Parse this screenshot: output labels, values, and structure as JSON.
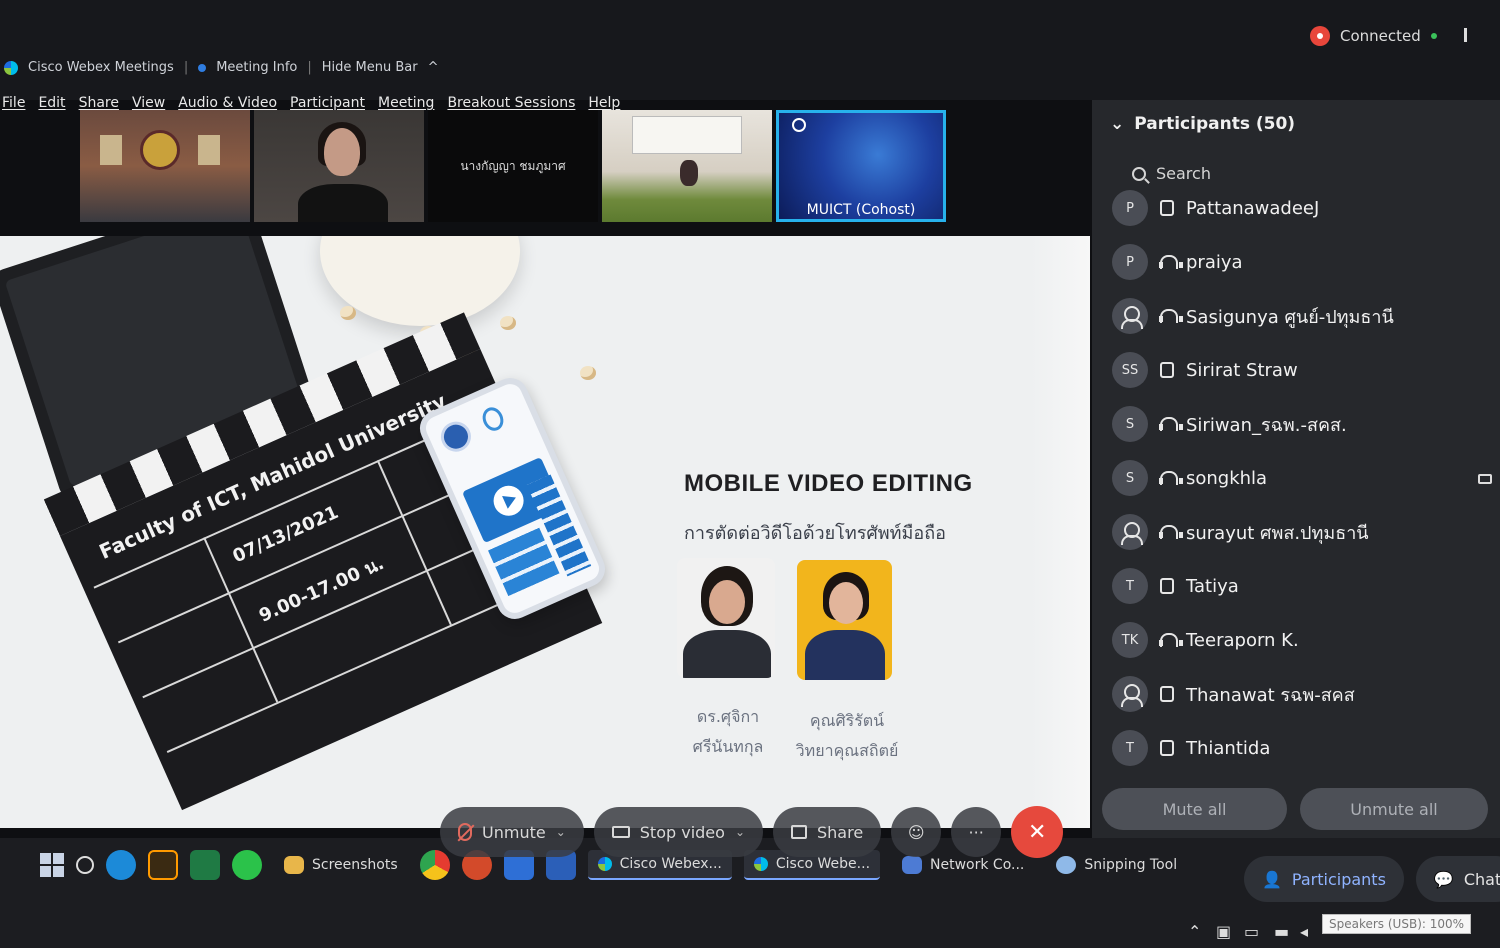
{
  "titlebar": {
    "app_name": "Cisco Webex Meetings",
    "meeting_info": "Meeting Info",
    "hide_menu": "Hide Menu Bar",
    "chevron": "^"
  },
  "menu": [
    "File",
    "Edit",
    "Share",
    "View",
    "Audio & Video",
    "Participant",
    "Meeting",
    "Breakout Sessions",
    "Help"
  ],
  "status": {
    "connected": "Connected"
  },
  "thumbnails": [
    {
      "icon": "room-video"
    },
    {
      "icon": "person-video"
    },
    {
      "label": "นางกัญญา ชมภูมาศ"
    },
    {
      "icon": "conference-video"
    },
    {
      "label": "MUICT  (Cohost)"
    }
  ],
  "slide": {
    "title": "MOBILE VIDEO EDITING",
    "subtitle": "การตัดต่อวิดีโอด้วยโทรศัพท์มือถือ",
    "clapper_line1": "Faculty of ICT, Mahidol University",
    "clapper_date": "07/13/2021",
    "clapper_time": "9.00-17.00 น.",
    "speaker1_line1": "ดร.ศุจิกา",
    "speaker1_line2": "ศรีนันทกุล",
    "speaker2_line1": "คุณศิริรัตน์",
    "speaker2_line2": "วิทยาคุณสถิตย์"
  },
  "controls": {
    "unmute": "Unmute",
    "stop_video": "Stop video",
    "share": "Share",
    "more": "···",
    "end": "✕"
  },
  "participants": {
    "header": "Participants (50)",
    "search_placeholder": "Search",
    "list": [
      {
        "initials": "P",
        "name": "PattanawadeeJ",
        "status": "phone"
      },
      {
        "initials": "P",
        "name": "praiya",
        "status": "headset"
      },
      {
        "initials": "",
        "name": "Sasigunya ศูนย์-ปทุมธานี",
        "status": "headset"
      },
      {
        "initials": "SS",
        "name": "Sirirat Straw",
        "status": "phone"
      },
      {
        "initials": "S",
        "name": "Siriwan_รฉพ.-สคส.",
        "status": "headset"
      },
      {
        "initials": "S",
        "name": "songkhla",
        "status": "headset"
      },
      {
        "initials": "",
        "name": "surayut ศพส.ปทุมธานี",
        "status": "headset"
      },
      {
        "initials": "T",
        "name": "Tatiya",
        "status": "phone"
      },
      {
        "initials": "TK",
        "name": "Teeraporn K.",
        "status": "headset"
      },
      {
        "initials": "",
        "name": "Thanawat รฉพ-สคส",
        "status": "phone"
      },
      {
        "initials": "T",
        "name": "Thiantida",
        "status": "phone"
      }
    ],
    "mute_all": "Mute all",
    "unmute_all": "Unmute all"
  },
  "bottom_tabs": {
    "participants": "Participants",
    "chat": "Chat"
  },
  "taskbar": {
    "screenshots": "Screenshots",
    "webex1": "Cisco Webex...",
    "webex2": "Cisco Webe...",
    "network": "Network Co...",
    "snipping": "Snipping Tool",
    "tooltip": "Speakers (USB): 100%"
  }
}
